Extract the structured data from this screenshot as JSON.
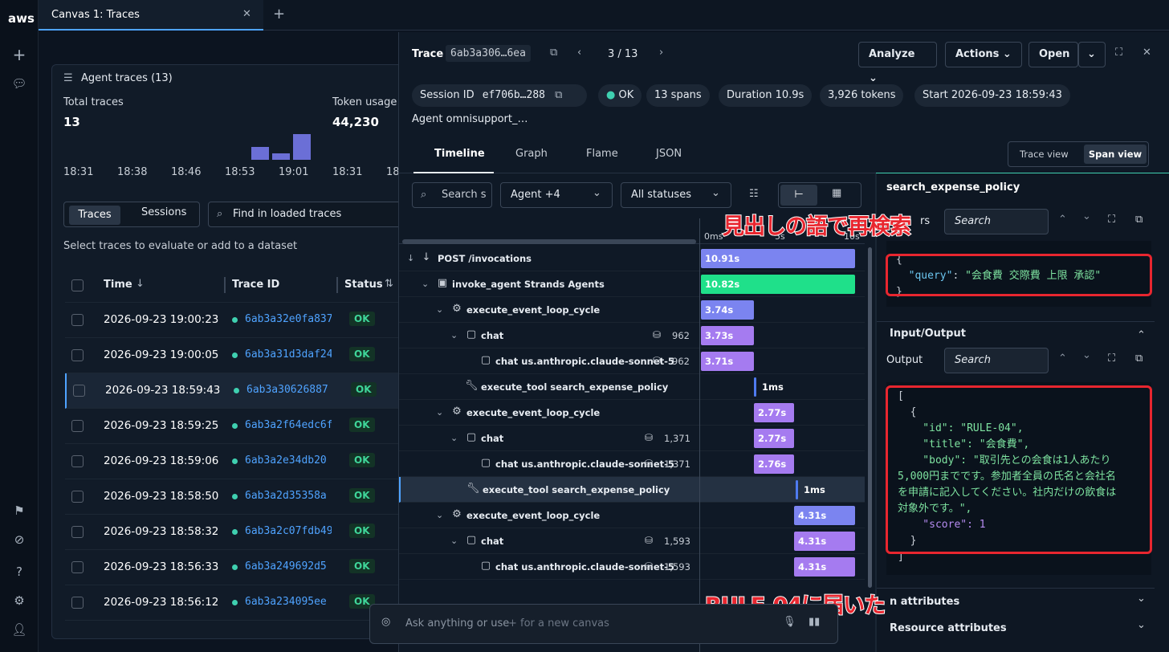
{
  "app": {
    "logo": "aws",
    "tab_title": "Canvas 1: Traces",
    "tab_close": "✕",
    "tab_add": "+"
  },
  "left_panel": {
    "title": "Agent traces (13)",
    "total_traces_label": "Total traces",
    "total_traces_value": "13",
    "token_usage_label": "Token usage",
    "token_usage_value": "44,230",
    "mini_chart_values": [
      0,
      0,
      0,
      0,
      0,
      0,
      0,
      0,
      0,
      2,
      1,
      4
    ],
    "axis_ticks": [
      "18:31",
      "18:38",
      "18:46",
      "18:53",
      "19:01"
    ],
    "axis_ticks2": [
      "18:31",
      "18"
    ],
    "seg_traces": "Traces",
    "seg_sessions": "Sessions",
    "find_placeholder": "Find in loaded traces",
    "hint": "Select traces to evaluate or add to a dataset",
    "col_time": "Time",
    "col_trace_id": "Trace ID",
    "col_status": "Status",
    "rows": [
      {
        "time": "2026-09-23 19:00:23",
        "id": "6ab3a32e0fa837",
        "status": "OK"
      },
      {
        "time": "2026-09-23 19:00:05",
        "id": "6ab3a31d3daf24",
        "status": "OK"
      },
      {
        "time": "2026-09-23 18:59:43",
        "id": "6ab3a30626887",
        "status": "OK"
      },
      {
        "time": "2026-09-23 18:59:25",
        "id": "6ab3a2f64edc6f",
        "status": "OK"
      },
      {
        "time": "2026-09-23 18:59:06",
        "id": "6ab3a2e34db20",
        "status": "OK"
      },
      {
        "time": "2026-09-23 18:58:50",
        "id": "6ab3a2d35358a",
        "status": "OK"
      },
      {
        "time": "2026-09-23 18:58:32",
        "id": "6ab3a2c07fdb49",
        "status": "OK"
      },
      {
        "time": "2026-09-23 18:56:33",
        "id": "6ab3a249692d5",
        "status": "OK"
      },
      {
        "time": "2026-09-23 18:56:12",
        "id": "6ab3a234095ee",
        "status": "OK"
      }
    ]
  },
  "trace": {
    "label": "Trace",
    "id": "6ab3a306…6ea",
    "pager": "3 / 13",
    "analyze": "Analyze",
    "actions": "Actions",
    "open": "Open",
    "session_label": "Session ID",
    "session_id": "ef706b…288",
    "status": "OK",
    "spans": "13 spans",
    "duration": "Duration  10.9s",
    "tokens": "3,926 tokens",
    "start": "Start  2026-09-23 18:59:43",
    "agent": "Agent  omnisupport_…",
    "tabs": [
      "Timeline",
      "Graph",
      "Flame",
      "JSON"
    ],
    "view_trace": "Trace view",
    "view_span": "Span view",
    "search_placeholder": "Search s",
    "agent_filter": "Agent +4",
    "status_filter": "All statuses",
    "axis": [
      "0ms",
      "5s",
      "10s"
    ]
  },
  "spans": [
    {
      "name": "POST /invocations",
      "tokens": "",
      "dur": "10.91s"
    },
    {
      "name": "invoke_agent Strands Agents",
      "tokens": "",
      "dur": "10.82s"
    },
    {
      "name": "execute_event_loop_cycle",
      "tokens": "",
      "dur": "3.74s"
    },
    {
      "name": "chat",
      "tokens": "962",
      "dur": "3.73s"
    },
    {
      "name": "chat us.anthropic.claude-sonnet-5",
      "tokens": "962",
      "dur": "3.71s"
    },
    {
      "name": "execute_tool search_expense_policy",
      "tokens": "",
      "dur": "1ms"
    },
    {
      "name": "execute_event_loop_cycle",
      "tokens": "",
      "dur": "2.77s"
    },
    {
      "name": "chat",
      "tokens": "1,371",
      "dur": "2.77s"
    },
    {
      "name": "chat us.anthropic.claude-sonnet-5",
      "tokens": "1,371",
      "dur": "2.76s"
    },
    {
      "name": "execute_tool search_expense_policy",
      "tokens": "",
      "dur": "1ms"
    },
    {
      "name": "execute_event_loop_cycle",
      "tokens": "",
      "dur": "4.31s"
    },
    {
      "name": "chat",
      "tokens": "1,593",
      "dur": "4.31s"
    },
    {
      "name": "chat us.anthropic.claude-sonnet-5",
      "tokens": "1,593",
      "dur": "4.31s"
    }
  ],
  "detail": {
    "title": "search_expense_policy",
    "params_label": "rs",
    "search": "Search",
    "input_json": "{\n  \"query\": \"会食費 交際費 上限 承認\"\n}",
    "io_label": "Input/Output",
    "output_label": "Output",
    "attr_label": "n attributes",
    "resource_label": "Resource attributes"
  },
  "chat_input": {
    "placeholder": "Ask anything or use",
    "hint": "+ for a new canvas"
  },
  "annotations": {
    "top": "見出しの語で再検索",
    "bottom": "RULE-04に届いた"
  },
  "output_lines": [
    "[",
    "  {",
    "    \"id\": \"RULE-04\",",
    "    \"title\": \"会食費\",",
    "    \"body\": \"取引先との会食は1人あたり",
    "5,000円までです。参加者全員の氏名と会社名",
    "を申請に記入してください。社内だけの飲食は",
    "対象外です。\",",
    "    \"score\": 1",
    "  }",
    "]"
  ]
}
